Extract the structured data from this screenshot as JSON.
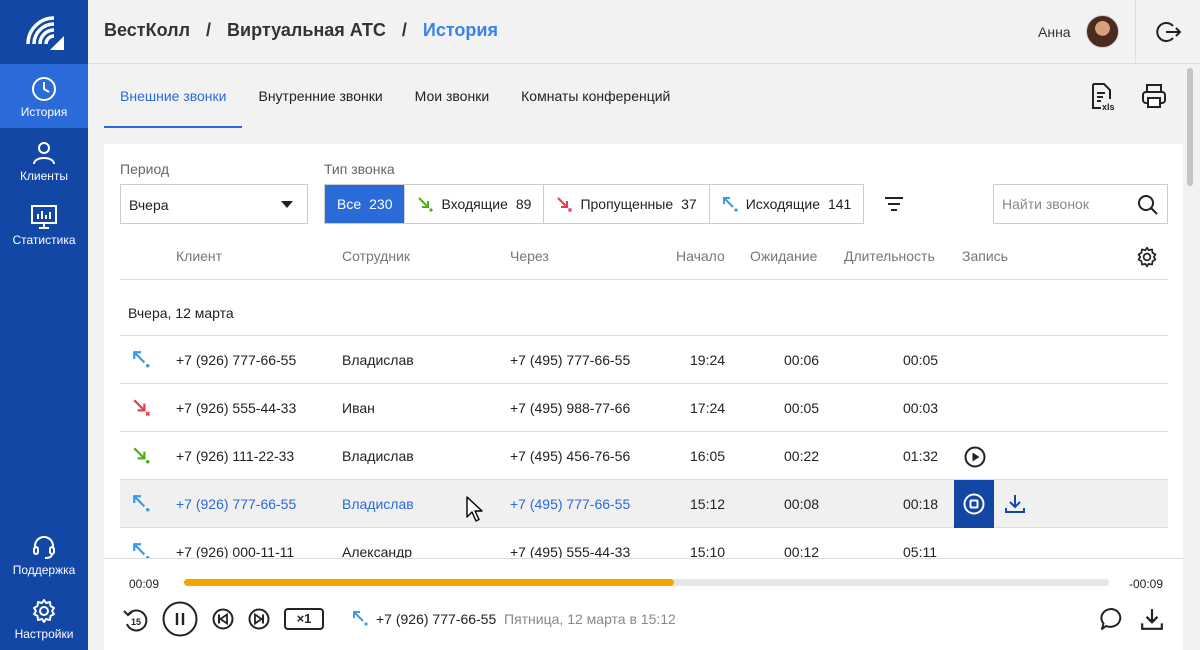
{
  "sidebar": {
    "items": [
      {
        "label": "История",
        "icon": "clock-icon"
      },
      {
        "label": "Клиенты",
        "icon": "user-icon"
      },
      {
        "label": "Статистика",
        "icon": "chart-icon"
      },
      {
        "label": "Поддержка",
        "icon": "headset-icon"
      },
      {
        "label": "Настройки",
        "icon": "gear-icon"
      }
    ],
    "accent": "#1347a5",
    "active_bg": "#2a6ad9"
  },
  "header": {
    "breadcrumb": [
      "ВестКолл",
      "Виртуальная АТС",
      "История"
    ],
    "separator": "/",
    "user_name": "Анна"
  },
  "tabs": [
    "Внешние звонки",
    "Внутренние звонки",
    "Мои звонки",
    "Комнаты конференций"
  ],
  "filters": {
    "period_label": "Период",
    "period_value": "Вчера",
    "type_label": "Тип звонка",
    "types": [
      {
        "label": "Все",
        "count": "230"
      },
      {
        "label": "Входящие",
        "count": "89"
      },
      {
        "label": "Пропущенные",
        "count": "37"
      },
      {
        "label": "Исходящие",
        "count": "141"
      }
    ],
    "search_placeholder": "Найти звонок"
  },
  "table": {
    "columns": [
      "Клиент",
      "Сотрудник",
      "Через",
      "Начало",
      "Ожидание",
      "Длительность",
      "Запись"
    ],
    "group_label": "Вчера, 12 марта",
    "rows": [
      {
        "dir": "outgoing",
        "client": "+7 (926) 777-66-55",
        "employee": "Владислав",
        "via": "+7 (495) 777-66-55",
        "start": "19:24",
        "wait": "00:06",
        "duration": "00:05"
      },
      {
        "dir": "missed",
        "client": "+7 (926) 555-44-33",
        "employee": "Иван",
        "via": "+7 (495) 988-77-66",
        "start": "17:24",
        "wait": "00:05",
        "duration": "00:03"
      },
      {
        "dir": "incoming",
        "client": "+7 (926) 111-22-33",
        "employee": "Владислав",
        "via": "+7 (495) 456-76-56",
        "start": "16:05",
        "wait": "00:22",
        "duration": "01:32"
      },
      {
        "dir": "outgoing",
        "client": "+7 (926) 777-66-55",
        "employee": "Владислав",
        "via": "+7 (495) 777-66-55",
        "start": "15:12",
        "wait": "00:08",
        "duration": "00:18"
      },
      {
        "dir": "outgoing",
        "client": "+7 (926) 000-11-11",
        "employee": "Александр",
        "via": "+7 (495) 555-44-33",
        "start": "15:10",
        "wait": "00:12",
        "duration": "05:11"
      }
    ]
  },
  "player": {
    "elapsed": "00:09",
    "remaining": "-00:09",
    "progress": 0.53,
    "speed": "×1",
    "number": "+7 (926) 777-66-55",
    "date": "Пятница, 12 марта в 15:12",
    "progress_color": "#f5a500"
  },
  "colors": {
    "incoming": "#4caf1a",
    "missed": "#e04050",
    "outgoing": "#3a9be8"
  }
}
